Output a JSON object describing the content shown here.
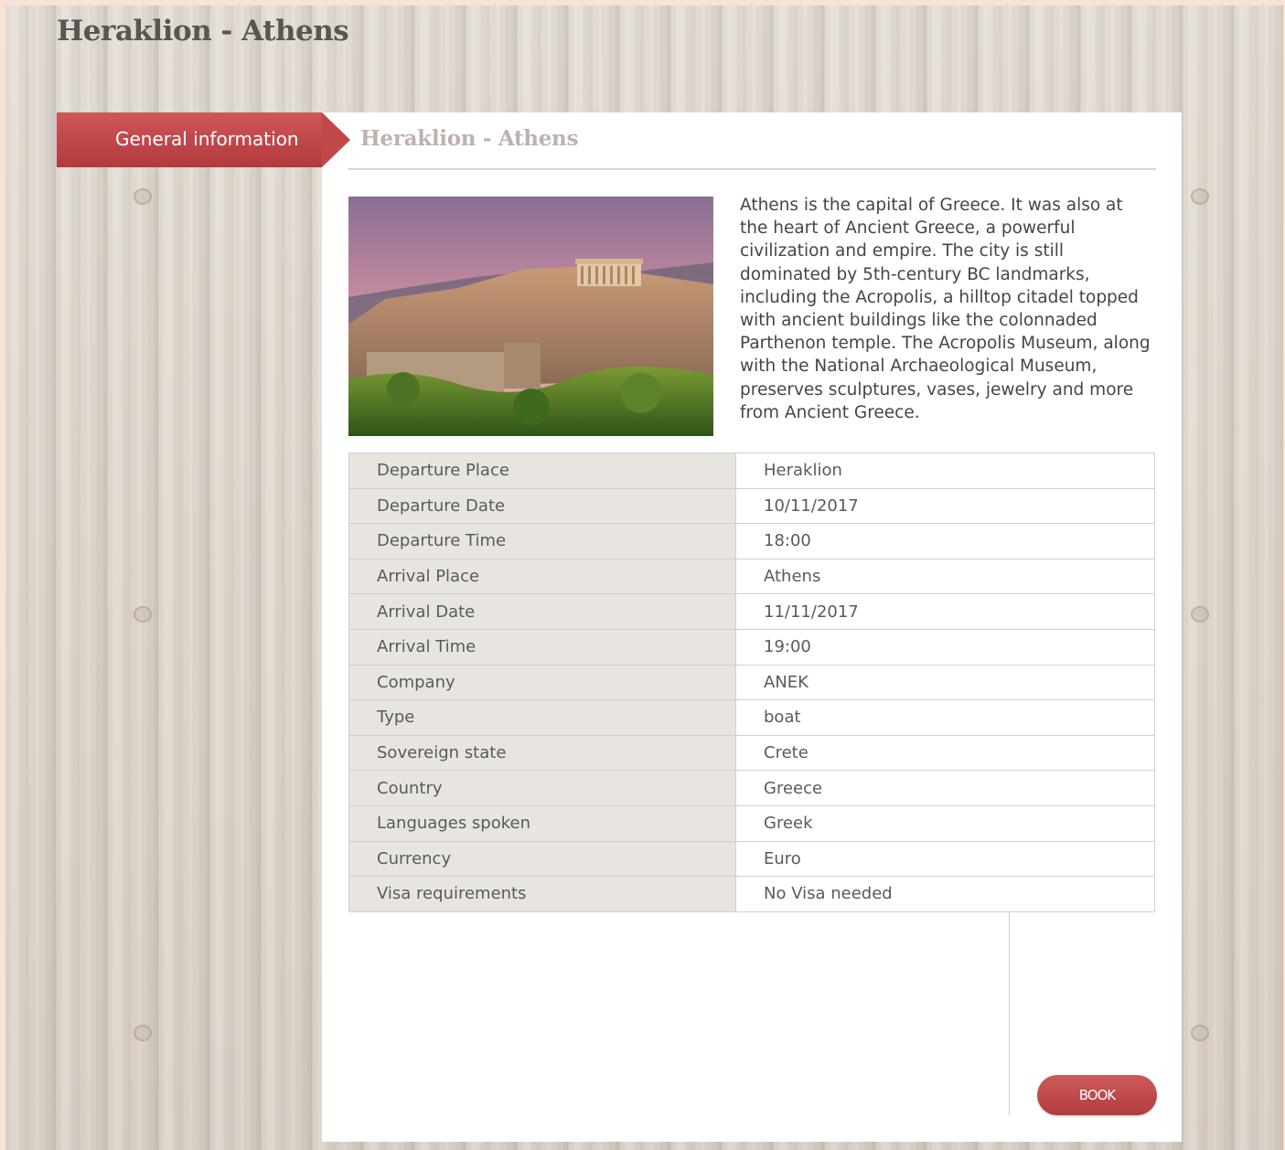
{
  "page": {
    "title": "Heraklion - Athens"
  },
  "tabs": [
    {
      "label": "General information",
      "active": true
    }
  ],
  "main": {
    "section_title": "Heraklion - Athens",
    "description": "Athens is the capital of Greece. It was also at the heart of Ancient Greece, a powerful civilization and empire. The city is still dominated by 5th-century BC landmarks, including the Acropolis, a hilltop citadel topped with ancient buildings like the colonnaded Parthenon temple. The Acropolis Museum, along with the National Archaeological Museum, preserves sculptures, vases, jewelry and more from Ancient Greece.",
    "details": [
      {
        "label": "Departure Place",
        "value": "Heraklion"
      },
      {
        "label": "Departure Date",
        "value": "10/11/2017"
      },
      {
        "label": "Departure Time",
        "value": "18:00"
      },
      {
        "label": "Arrival Place",
        "value": "Athens"
      },
      {
        "label": "Arrival Date",
        "value": "11/11/2017"
      },
      {
        "label": "Arrival Time",
        "value": "19:00"
      },
      {
        "label": "Company",
        "value": "ANEK"
      },
      {
        "label": "Type",
        "value": "boat"
      },
      {
        "label": "Sovereign state",
        "value": "Crete"
      },
      {
        "label": "Country",
        "value": "Greece"
      },
      {
        "label": "Languages spoken",
        "value": "Greek"
      },
      {
        "label": "Currency",
        "value": "Euro"
      },
      {
        "label": "Visa requirements",
        "value": "No Visa needed"
      }
    ]
  },
  "actions": {
    "book_label": "BOOK"
  },
  "colors": {
    "accent": "#c1484a",
    "title_text": "#5b5551",
    "section_title_text": "#bdb2ad",
    "table_label_bg": "#e8e5e1"
  }
}
